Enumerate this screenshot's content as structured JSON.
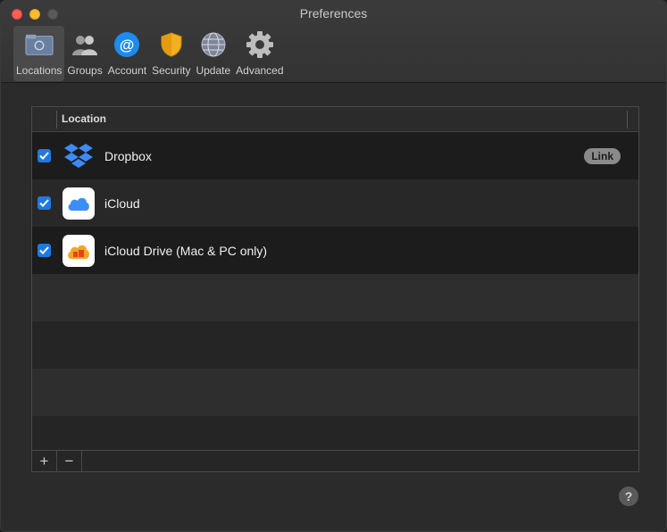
{
  "window": {
    "title": "Preferences"
  },
  "tabs": [
    {
      "label": "Locations",
      "icon": "locations-icon",
      "active": true
    },
    {
      "label": "Groups",
      "icon": "groups-icon",
      "active": false
    },
    {
      "label": "Account",
      "icon": "account-icon",
      "active": false
    },
    {
      "label": "Security",
      "icon": "security-icon",
      "active": false
    },
    {
      "label": "Update",
      "icon": "update-icon",
      "active": false
    },
    {
      "label": "Advanced",
      "icon": "advanced-icon",
      "active": false
    }
  ],
  "table": {
    "column_header": "Location",
    "rows": [
      {
        "label": "Dropbox",
        "checked": true,
        "icon": "dropbox-icon",
        "badge": "Link"
      },
      {
        "label": "iCloud",
        "checked": true,
        "icon": "icloud-icon"
      },
      {
        "label": "iCloud Drive (Mac & PC only)",
        "checked": true,
        "icon": "icloud-drive-icon"
      }
    ]
  },
  "controls": {
    "add_label": "+",
    "remove_label": "−",
    "help_label": "?"
  },
  "colors": {
    "accent": "#1f7ae0",
    "dropbox": "#3d8bf7",
    "icloud": "#3b8ef5",
    "icloud_drive": "#f5a623"
  }
}
